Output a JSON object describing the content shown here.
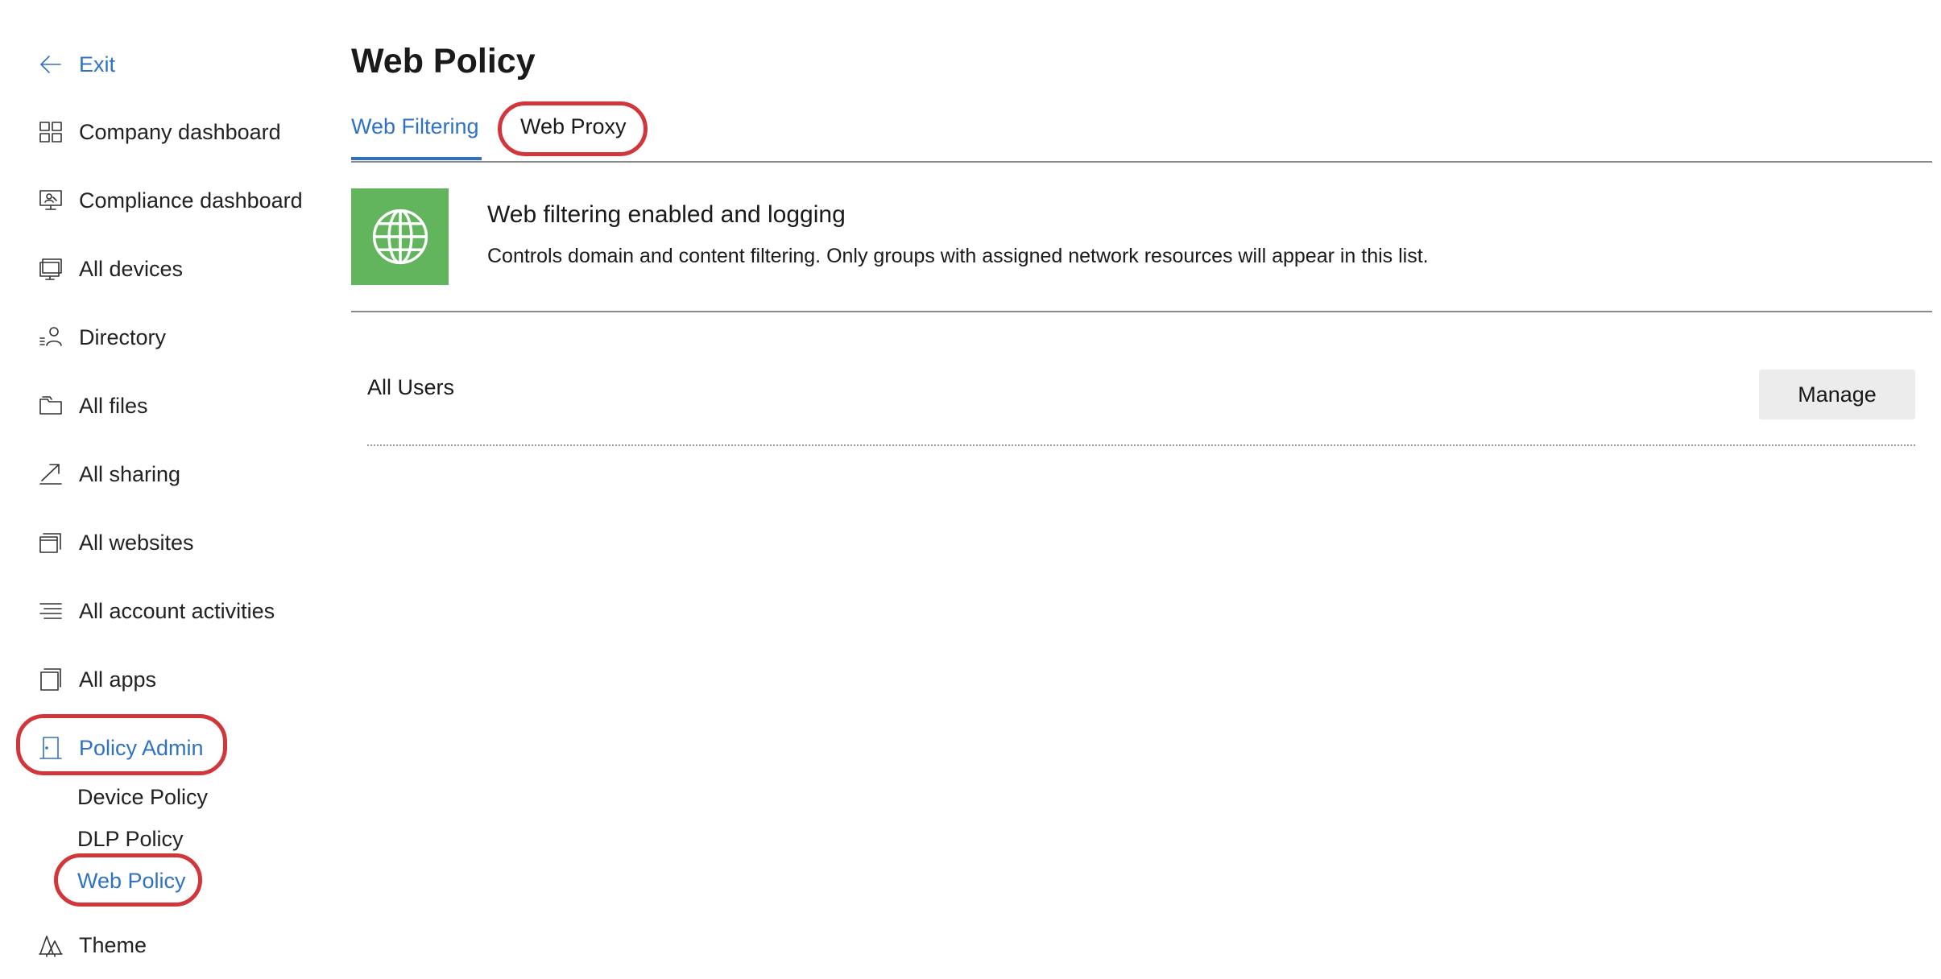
{
  "sidebar": {
    "exit_label": "Exit",
    "items": [
      {
        "label": "Company dashboard",
        "icon": "grid-dashboard-icon"
      },
      {
        "label": "Compliance dashboard",
        "icon": "monitor-user-icon"
      },
      {
        "label": "All devices",
        "icon": "devices-icon"
      },
      {
        "label": "Directory",
        "icon": "user-list-icon"
      },
      {
        "label": "All files",
        "icon": "folder-icon"
      },
      {
        "label": "All sharing",
        "icon": "share-arrow-icon"
      },
      {
        "label": "All websites",
        "icon": "browser-windows-icon"
      },
      {
        "label": "All account activities",
        "icon": "activity-list-icon"
      },
      {
        "label": "All apps",
        "icon": "apps-icon"
      },
      {
        "label": "Policy Admin",
        "icon": "door-icon"
      }
    ],
    "sub_items": [
      {
        "label": "Device Policy"
      },
      {
        "label": "DLP Policy"
      },
      {
        "label": "Web Policy"
      }
    ],
    "theme_label": "Theme",
    "theme_icon": "trees-icon"
  },
  "main": {
    "title": "Web Policy",
    "tabs": [
      {
        "label": "Web Filtering",
        "active": true
      },
      {
        "label": "Web Proxy",
        "active": false
      }
    ],
    "banner": {
      "icon": "globe-icon",
      "icon_bg": "#62b55d",
      "title": "Web filtering enabled and logging",
      "description": "Controls domain and content filtering. Only groups with assigned network resources will appear in this list."
    },
    "groups": [
      {
        "name": "All Users",
        "action_label": "Manage"
      }
    ]
  },
  "colors": {
    "accent": "#2f72c4",
    "highlight_circle": "#d0363a",
    "banner_green": "#62b55d"
  }
}
